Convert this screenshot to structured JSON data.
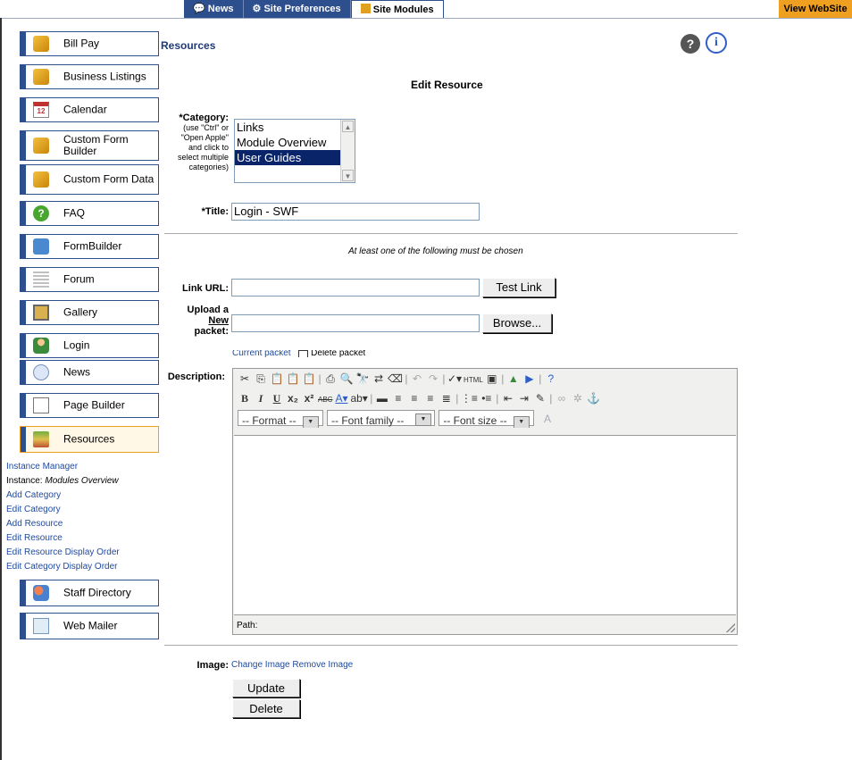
{
  "topnav": {
    "tabs": [
      {
        "label": "News"
      },
      {
        "label": "Site Preferences"
      },
      {
        "label": "Site Modules"
      }
    ],
    "view_site": "View WebSite"
  },
  "sidebar": {
    "items": [
      {
        "label": "Bill Pay",
        "icon": "box-icon"
      },
      {
        "label": "Business Listings",
        "icon": "box-icon"
      },
      {
        "label": "Calendar",
        "icon": "calendar-icon"
      },
      {
        "label": "Custom Form Builder",
        "icon": "box-icon"
      },
      {
        "label": "Custom Form Data",
        "icon": "box-icon"
      },
      {
        "label": "FAQ",
        "icon": "help-icon"
      },
      {
        "label": "FormBuilder",
        "icon": "form-icon"
      },
      {
        "label": "Forum",
        "icon": "forum-icon"
      },
      {
        "label": "Gallery",
        "icon": "gallery-icon"
      },
      {
        "label": "Login",
        "icon": "login-icon"
      },
      {
        "label": "News",
        "icon": "news-icon"
      },
      {
        "label": "Page Builder",
        "icon": "page-icon"
      },
      {
        "label": "Resources",
        "icon": "resources-icon"
      },
      {
        "label": "Staff Directory",
        "icon": "people-icon"
      },
      {
        "label": "Web Mailer",
        "icon": "mail-icon"
      }
    ],
    "sub_links": {
      "instance_manager": "Instance Manager",
      "instance_label": "Instance: ",
      "instance_value": "Modules Overview",
      "add_category": "Add Category",
      "edit_category": "Edit Category",
      "add_resource": "Add Resource",
      "edit_resource": "Edit Resource",
      "edit_resource_order": "Edit Resource Display Order",
      "edit_category_order": "Edit Category Display Order"
    }
  },
  "main": {
    "section_title": "Resources",
    "form_heading": "Edit Resource",
    "category_label": "*Category:",
    "category_note": "(use \"Ctrl\" or \"Open Apple\" and click to select multiple categories)",
    "category_options": [
      "Links",
      "Module Overview",
      "User Guides"
    ],
    "category_selected": "User Guides",
    "title_label": "*Title:",
    "title_value": "Login - SWF",
    "must_choose_note": "At least one of the following must be chosen",
    "link_url_label": "Link URL:",
    "link_url_value": "",
    "test_link_button": "Test Link",
    "upload_label_1": "Upload a",
    "upload_label_2": "New",
    "upload_label_3": "packet:",
    "browse_button": "Browse...",
    "current_packet": "Current packet",
    "delete_packet": "Delete packet",
    "description_label": "Description:",
    "editor": {
      "format_select": "-- Format --",
      "font_family_select": "-- Font family --",
      "font_size_select": "-- Font size --",
      "path_label": "Path:"
    },
    "image_label": "Image:",
    "change_image": "Change Image",
    "remove_image": "Remove Image",
    "update_button": "Update",
    "delete_button": "Delete"
  }
}
